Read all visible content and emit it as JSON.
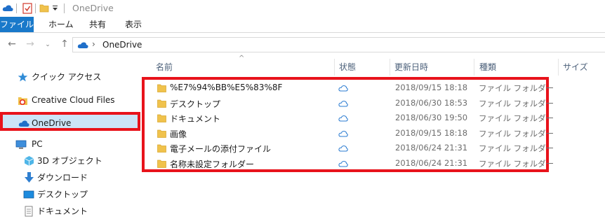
{
  "window": {
    "title": "OneDrive"
  },
  "ribbon": {
    "tabs": [
      "ファイル",
      "ホーム",
      "共有",
      "表示"
    ]
  },
  "address": {
    "path": "OneDrive"
  },
  "nav": {
    "quick_access": "クイック アクセス",
    "creative_cloud": "Creative Cloud Files",
    "onedrive": "OneDrive",
    "pc": "PC",
    "objects3d": "3D オブジェクト",
    "downloads": "ダウンロード",
    "desktop": "デスクトップ",
    "documents": "ドキュメント"
  },
  "columns": {
    "name": "名前",
    "status": "状態",
    "modified": "更新日時",
    "type": "種類",
    "size": "サイズ"
  },
  "files": [
    {
      "name": "%E7%94%BB%E5%83%8F",
      "modified": "2018/09/15 18:18",
      "type": "ファイル フォルダー"
    },
    {
      "name": "デスクトップ",
      "modified": "2018/06/30 18:53",
      "type": "ファイル フォルダー"
    },
    {
      "name": "ドキュメント",
      "modified": "2018/06/30 19:50",
      "type": "ファイル フォルダー"
    },
    {
      "name": "画像",
      "modified": "2018/09/15 18:18",
      "type": "ファイル フォルダー"
    },
    {
      "name": "電子メールの添付ファイル",
      "modified": "2018/06/24 21:31",
      "type": "ファイル フォルダー"
    },
    {
      "name": "名称未設定フォルダー",
      "modified": "2018/06/24 21:31",
      "type": "ファイル フォルダー"
    }
  ],
  "colors": {
    "accent": "#1979ca",
    "highlight": "#e8131b",
    "folder": "#f0c24c"
  }
}
